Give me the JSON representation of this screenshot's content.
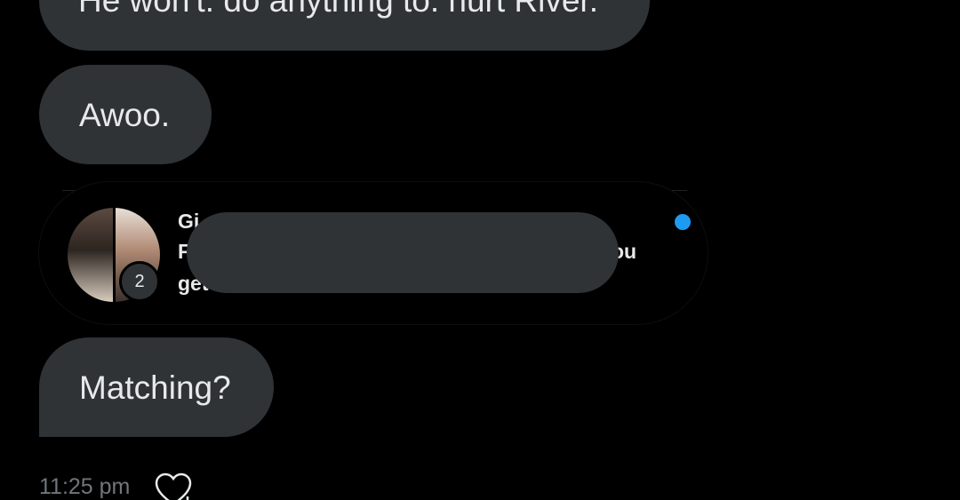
{
  "messages": {
    "first": "He won't. do anything to. hurt River.",
    "second": "Awoo.",
    "third": "Matching?"
  },
  "shared_conversation": {
    "name_fragment": "Gi",
    "line2_start": "F",
    "line2_end": "ou",
    "line3_fragment": "get",
    "participant_count": "2",
    "unread_dot_color": "#1d9bf0"
  },
  "footer": {
    "timestamp": "11:25 pm",
    "reaction_icon": "heart-add-icon"
  }
}
